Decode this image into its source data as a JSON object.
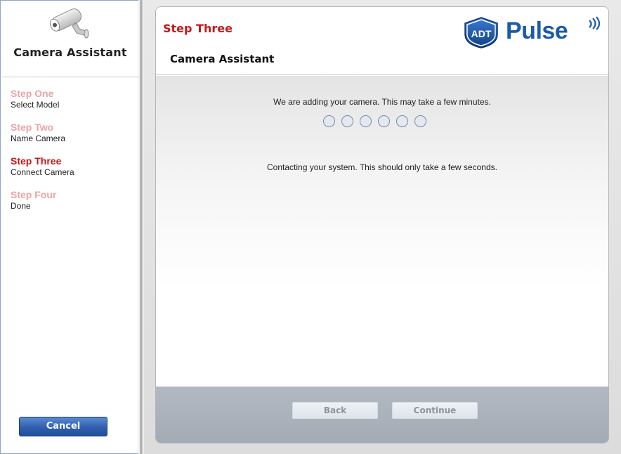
{
  "sidebar": {
    "title": "Camera Assistant",
    "steps": [
      {
        "title": "Step One",
        "subtitle": "Select Model",
        "active": false
      },
      {
        "title": "Step Two",
        "subtitle": "Name Camera",
        "active": false
      },
      {
        "title": "Step Three",
        "subtitle": "Connect Camera",
        "active": true
      },
      {
        "title": "Step Four",
        "subtitle": "Done",
        "active": false
      }
    ],
    "cancel_label": "Cancel"
  },
  "header": {
    "step": "Step Three",
    "title": "Camera Assistant",
    "brand_badge": "ADT",
    "brand_name": "Pulse"
  },
  "body": {
    "adding_message": "We are adding your camera. This may take a few minutes.",
    "progress_dot_count": 6,
    "status_message": "Contacting your system. This should only take a few seconds."
  },
  "footer": {
    "back_label": "Back",
    "continue_label": "Continue",
    "buttons_disabled": true
  },
  "colors": {
    "active_step": "#c41818",
    "inactive_step": "#eda3a3",
    "brand_blue": "#1b5ba8",
    "cancel_button": "#2f5fae"
  }
}
